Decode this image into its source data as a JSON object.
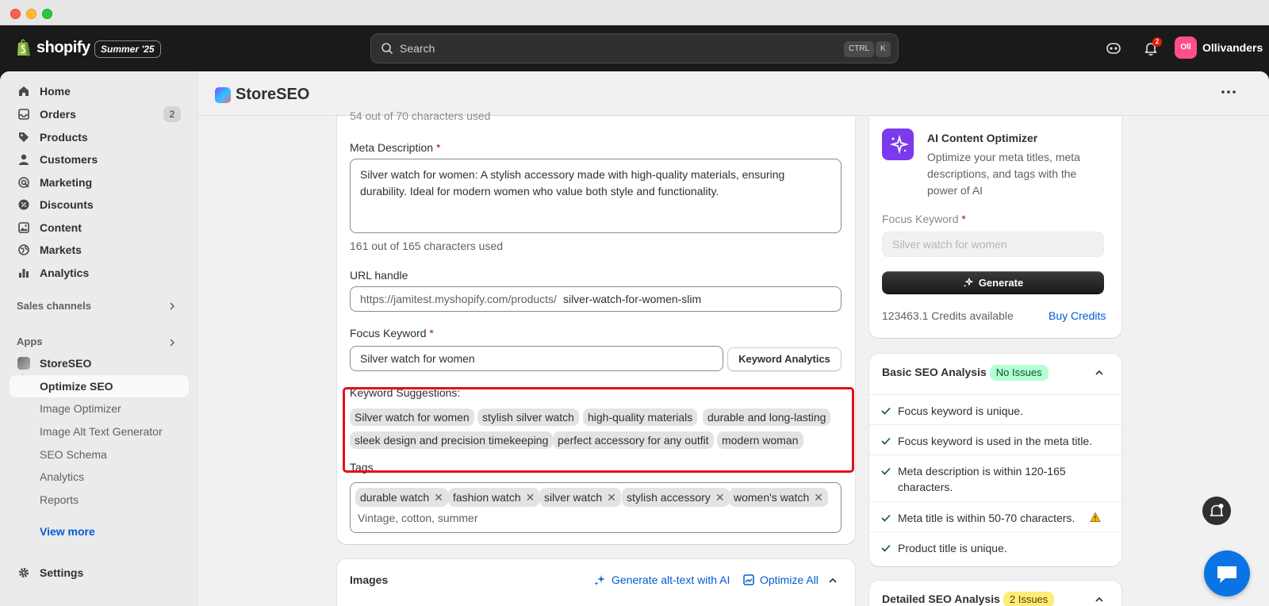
{
  "topbar": {
    "brand": "shopify",
    "edition": "Summer '25",
    "search_placeholder": "Search",
    "shortcut_ctrl": "CTRL",
    "shortcut_k": "K",
    "notification_count": "2",
    "avatar_initials": "Oll",
    "shop_name": "Ollivanders"
  },
  "sidebar": {
    "items": [
      {
        "label": "Home",
        "icon": "home-icon"
      },
      {
        "label": "Orders",
        "icon": "inbox-icon",
        "count": "2"
      },
      {
        "label": "Products",
        "icon": "tag-icon"
      },
      {
        "label": "Customers",
        "icon": "person-icon"
      },
      {
        "label": "Marketing",
        "icon": "target-icon"
      },
      {
        "label": "Discounts",
        "icon": "discount-icon"
      },
      {
        "label": "Content",
        "icon": "image-icon"
      },
      {
        "label": "Markets",
        "icon": "globe-icon"
      },
      {
        "label": "Analytics",
        "icon": "bar-chart-icon"
      }
    ],
    "sales_channels_label": "Sales channels",
    "apps_label": "Apps",
    "app_name": "StoreSEO",
    "app_subitems": [
      "Optimize SEO",
      "Image Optimizer",
      "Image Alt Text Generator",
      "SEO Schema",
      "Analytics",
      "Reports"
    ],
    "view_more": "View more",
    "settings": "Settings"
  },
  "header": {
    "app_title": "StoreSEO"
  },
  "form": {
    "meta_title_counter_partial": "54 out of 70 characters used",
    "meta_description_label": "Meta Description",
    "required_mark": "*",
    "meta_description_value": "Silver watch for women: A stylish accessory made with high-quality materials, ensuring durability. Ideal for modern women who value both style and functionality.",
    "meta_description_counter": "161 out of 165 characters used",
    "url_handle_label": "URL handle",
    "url_prefix": "https://jamitest.myshopify.com/products/",
    "url_handle_value": "silver-watch-for-women-slim",
    "focus_keyword_label": "Focus Keyword",
    "focus_keyword_value": "Silver watch for women",
    "keyword_analytics_button": "Keyword Analytics",
    "keyword_suggestions_label": "Keyword Suggestions:",
    "keyword_suggestions": [
      "Silver watch for women",
      "stylish silver watch",
      "high-quality materials",
      "durable and long-lasting",
      "sleek design and precision timekeeping",
      "perfect accessory for any outfit",
      "modern woman"
    ],
    "tags_label": "Tags",
    "tags": [
      "durable watch",
      "fashion watch",
      "silver watch",
      "stylish accessory",
      "women's watch"
    ],
    "tags_placeholder": "Vintage, cotton, summer"
  },
  "images_card": {
    "title": "Images",
    "generate_alt": "Generate alt-text with AI",
    "optimize_all": "Optimize All"
  },
  "ai_card": {
    "title": "AI Content Optimizer",
    "description": "Optimize your meta titles, meta descriptions, and tags with the power of AI",
    "focus_keyword_label": "Focus Keyword",
    "focus_keyword_placeholder": "Silver watch for women",
    "generate_button": "Generate",
    "credits": "123463.1 Credits available",
    "buy_credits": "Buy Credits"
  },
  "basic_seo": {
    "title": "Basic SEO Analysis",
    "badge": "No Issues",
    "checks": [
      "Focus keyword is unique.",
      "Focus keyword is used in the meta title.",
      "Meta description is within 120-165 characters.",
      "Meta title is within 50-70 characters.",
      "Product title is unique."
    ]
  },
  "detailed_seo": {
    "title": "Detailed SEO Analysis",
    "badge": "2 Issues"
  },
  "colors": {
    "accent_blue": "#005bd3",
    "highlight_red": "#e0101a",
    "ai_purple": "#7c3aed",
    "success_green": "#b4fed2",
    "warning_yellow": "#ffeb78"
  }
}
